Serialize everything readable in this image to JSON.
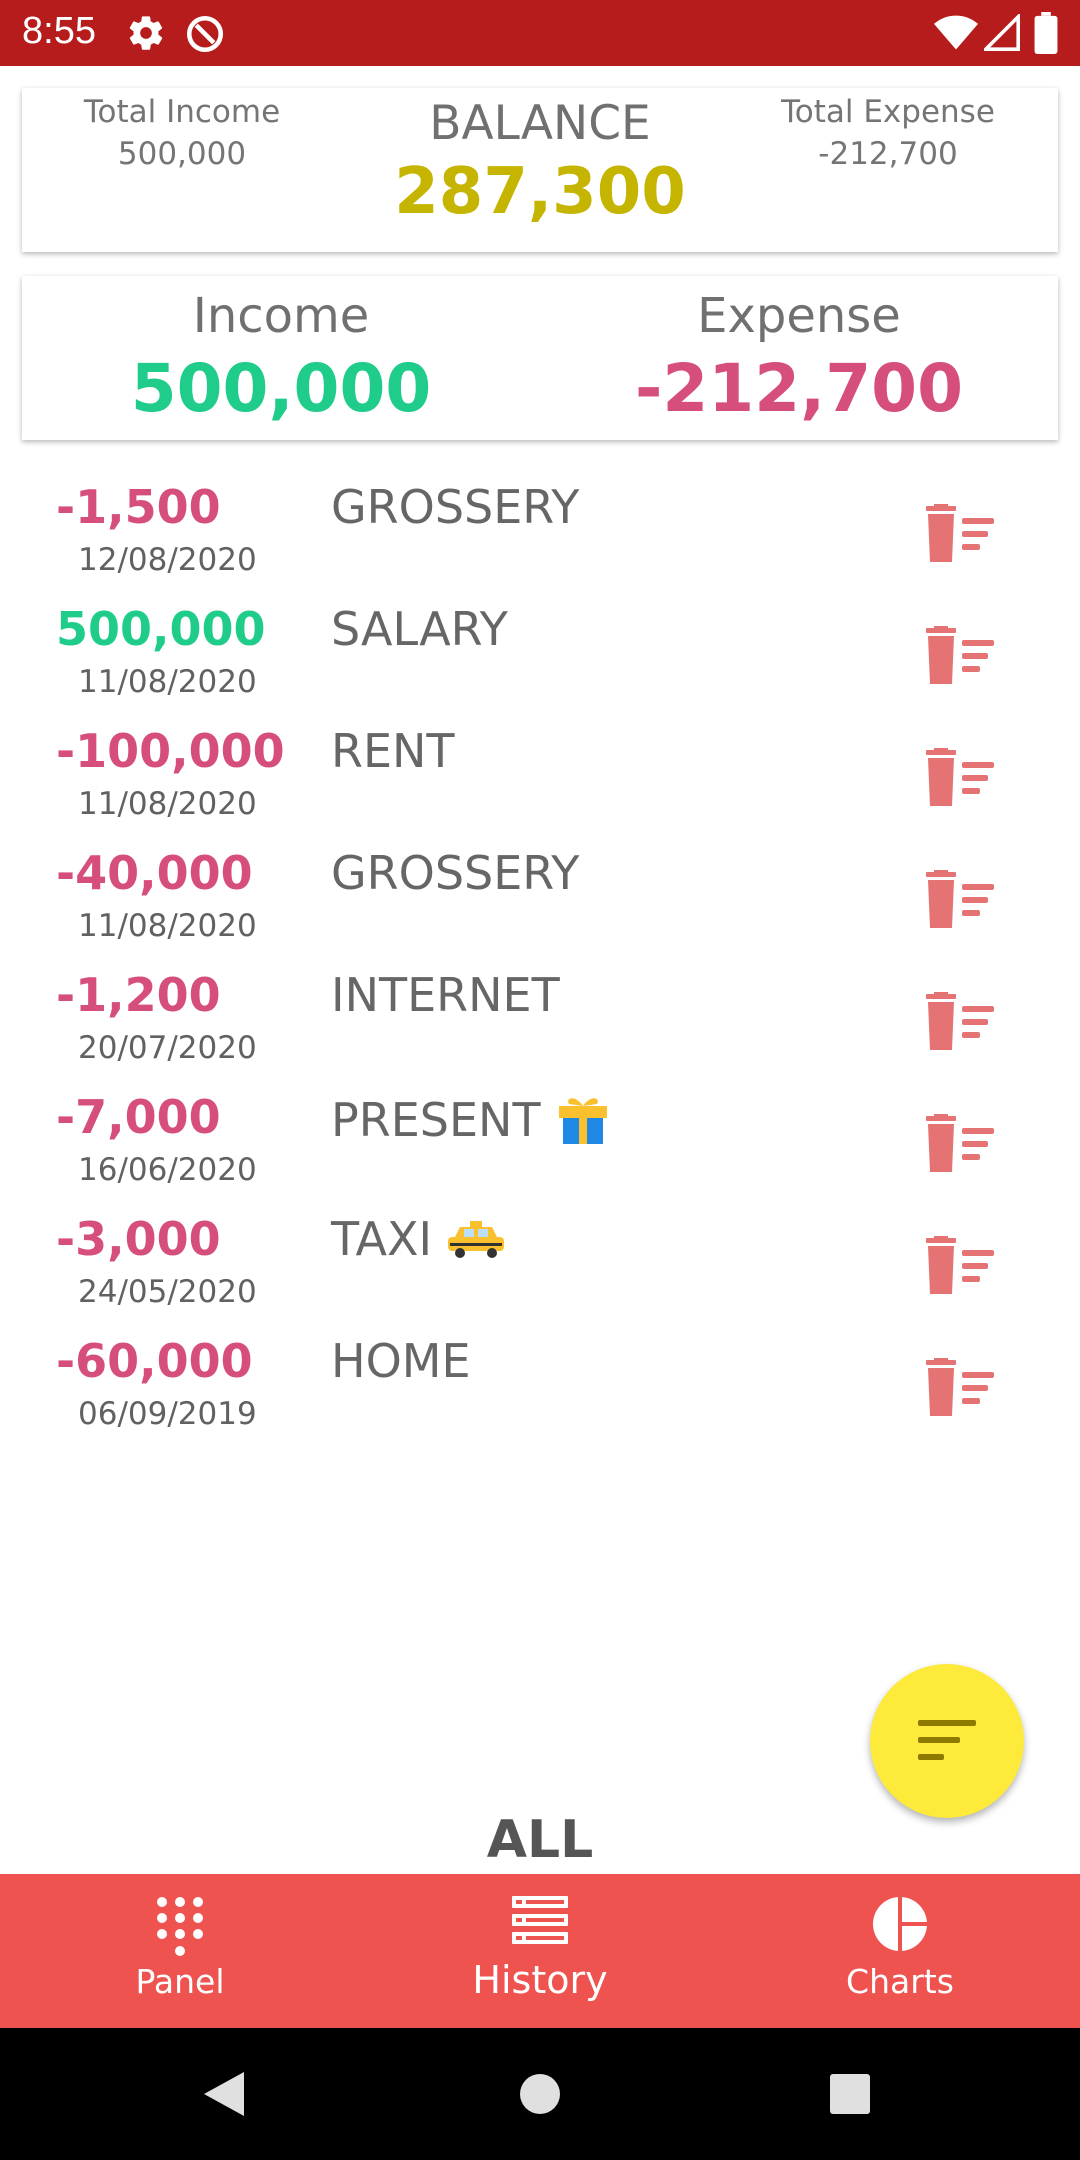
{
  "status_bar": {
    "time": "8:55"
  },
  "summary": {
    "total_income_label": "Total Income",
    "total_income_value": "500,000",
    "balance_label": "BALANCE",
    "balance_value": "287,300",
    "total_expense_label": "Total Expense",
    "total_expense_value": "-212,700"
  },
  "filtered": {
    "income_label": "Income",
    "income_value": "500,000",
    "expense_label": "Expense",
    "expense_value": "-212,700"
  },
  "transactions": [
    {
      "amount": "-1,500",
      "date": "12/08/2020",
      "title": "GROSSERY",
      "type": "expense"
    },
    {
      "amount": "500,000",
      "date": "11/08/2020",
      "title": "SALARY",
      "type": "income"
    },
    {
      "amount": "-100,000",
      "date": "11/08/2020",
      "title": "RENT",
      "type": "expense"
    },
    {
      "amount": "-40,000",
      "date": "11/08/2020",
      "title": "GROSSERY",
      "type": "expense"
    },
    {
      "amount": "-1,200",
      "date": "20/07/2020",
      "title": "INTERNET",
      "type": "expense"
    },
    {
      "amount": "-7,000",
      "date": "16/06/2020",
      "title": "PRESENT",
      "type": "expense",
      "emoji": "gift-icon"
    },
    {
      "amount": "-3,000",
      "date": "24/05/2020",
      "title": "TAXI",
      "type": "expense",
      "emoji": "taxi-icon"
    },
    {
      "amount": "-60,000",
      "date": "06/09/2019",
      "title": "HOME",
      "type": "expense"
    }
  ],
  "filter_label": "ALL",
  "bottom_nav": {
    "items": [
      {
        "label": "Panel",
        "icon": "dialpad-icon"
      },
      {
        "label": "History",
        "icon": "list-icon",
        "active": true
      },
      {
        "label": "Charts",
        "icon": "pie-chart-icon"
      }
    ]
  },
  "colors": {
    "status_bar": "#b71c1c",
    "nav_bar": "#ef5350",
    "income": "#1fcc8a",
    "expense": "#d64f7c",
    "balance": "#c5b400",
    "fab": "#fdea3a",
    "delete_icon": "#e57373"
  }
}
